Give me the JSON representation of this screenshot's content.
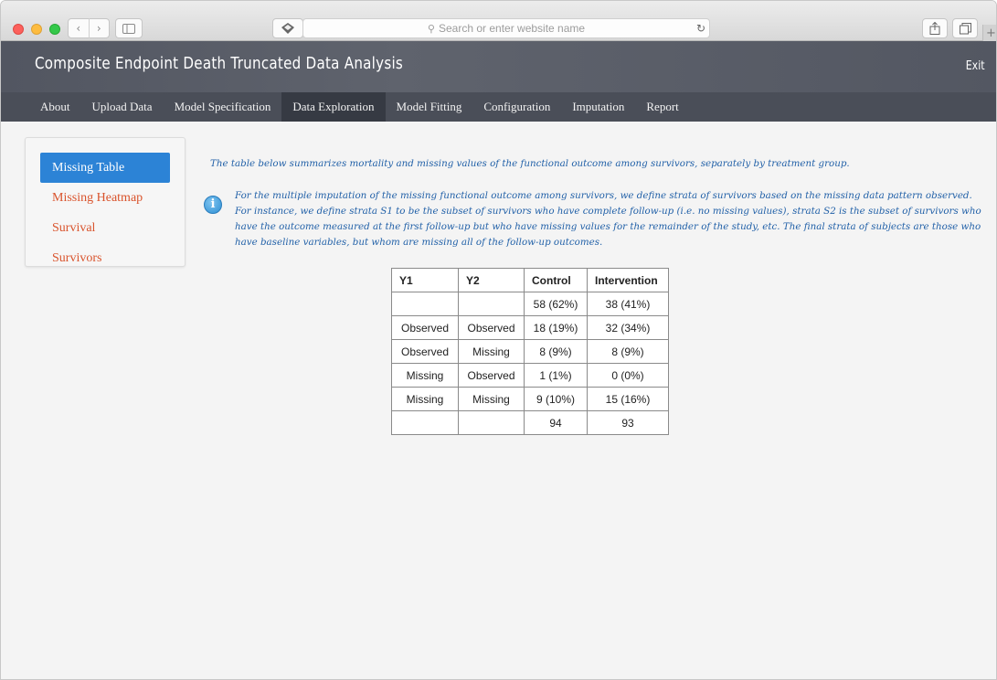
{
  "browser": {
    "address_placeholder": "Search or enter website name",
    "icons": [
      "close-window-icon",
      "minimize-window-icon",
      "zoom-window-icon",
      "back-icon",
      "forward-icon",
      "sidebar-icon",
      "extension-icon",
      "search-icon",
      "reload-icon",
      "share-icon",
      "tabs-icon",
      "new-tab-icon"
    ]
  },
  "app": {
    "title": "Composite Endpoint Death Truncated Data Analysis",
    "exit_label": "Exit"
  },
  "nav": {
    "tabs": [
      {
        "label": "About"
      },
      {
        "label": "Upload Data"
      },
      {
        "label": "Model Specification"
      },
      {
        "label": "Data Exploration",
        "active": true
      },
      {
        "label": "Model Fitting"
      },
      {
        "label": "Configuration"
      },
      {
        "label": "Imputation"
      },
      {
        "label": "Report"
      }
    ]
  },
  "side_menu": {
    "items": [
      {
        "label": "Missing Table",
        "active": true
      },
      {
        "label": "Missing Heatmap"
      },
      {
        "label": "Survival"
      },
      {
        "label": "Survivors"
      }
    ]
  },
  "main": {
    "intro": "The table below summarizes mortality and missing values of the functional outcome among survivors, separately by treatment group.",
    "info": "For the multiple imputation of the missing functional outcome among survivors, we define strata of survivors based on the missing data pattern observed. For instance, we define strata S1 to be the subset of survivors who have complete follow-up (i.e. no missing values), strata S2 is the subset of survivors who have the outcome measured at the first follow-up but who have missing values for the remainder of the study, etc. The final strata of subjects are those who have baseline variables, but whom are missing all of the follow-up outcomes.",
    "table": {
      "headers": [
        "Y1",
        "Y2",
        "Control",
        "Intervention"
      ],
      "rows": [
        [
          "",
          "",
          "58 (62%)",
          "38 (41%)"
        ],
        [
          "Observed",
          "Observed",
          "18 (19%)",
          "32 (34%)"
        ],
        [
          "Observed",
          "Missing",
          "8 (9%)",
          "8 (9%)"
        ],
        [
          "Missing",
          "Observed",
          "1 (1%)",
          "0 (0%)"
        ],
        [
          "Missing",
          "Missing",
          "9 (10%)",
          "15 (16%)"
        ],
        [
          "",
          "",
          "94",
          "93"
        ]
      ]
    }
  },
  "colors": {
    "header_bg": "#585c66",
    "nav_bg": "#4a4e58",
    "nav_active_bg": "#363a43",
    "side_active_bg": "#2c83d6",
    "side_link": "#d9532c",
    "body_text_blue": "#2261a8"
  }
}
